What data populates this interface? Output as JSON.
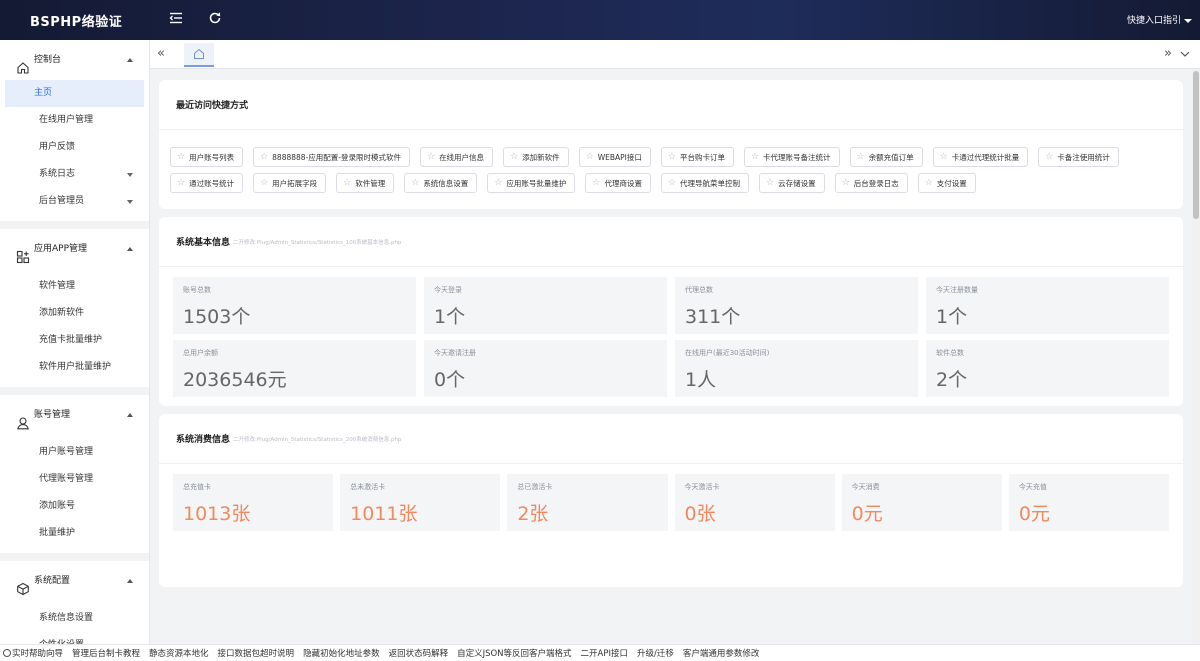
{
  "app": {
    "title": "BSPHP络验证",
    "quick_menu": "快捷入口指引"
  },
  "sidebar": {
    "groups": [
      {
        "label": "控制台",
        "icon": "home-icon",
        "items": [
          {
            "label": "主页",
            "active": true
          },
          {
            "label": "在线用户管理"
          },
          {
            "label": "用户反馈"
          },
          {
            "label": "系统日志",
            "has_submenu": true
          },
          {
            "label": "后台管理员",
            "has_submenu": true
          }
        ]
      },
      {
        "label": "应用APP管理",
        "icon": "apps-icon",
        "items": [
          {
            "label": "软件管理"
          },
          {
            "label": "添加新软件"
          },
          {
            "label": "充值卡批量维护"
          },
          {
            "label": "软件用户批量维护"
          }
        ]
      },
      {
        "label": "账号管理",
        "icon": "user-icon",
        "items": [
          {
            "label": "用户账号管理"
          },
          {
            "label": "代理账号管理"
          },
          {
            "label": "添加账号"
          },
          {
            "label": "批量维护"
          }
        ]
      },
      {
        "label": "系统配置",
        "icon": "cube-icon",
        "items": [
          {
            "label": "系统信息设置"
          },
          {
            "label": "个性化设置"
          }
        ]
      }
    ]
  },
  "shortcuts": {
    "title": "最近访问快捷方式",
    "items": [
      "用户账号列表",
      "8888888-应用配置-登录限时模式软件",
      "在线用户信息",
      "添加新软件",
      "WEBAPI接口",
      "平台购卡订单",
      "卡代理账号备注统计",
      "余额充值订单",
      "卡通过代理统计批量",
      "卡备注使用统计",
      "通过账号统计",
      "用户拓展字段",
      "软件管理",
      "系统信息设置",
      "应用账号批量维护",
      "代理商设置",
      "代理导航菜单控制",
      "云存储设置",
      "后台登录日志",
      "支付设置"
    ]
  },
  "basic_info": {
    "title": "系统基本信息",
    "note": "二开修改:Plug/Admin_Statistics/Statistics_100系统基本信息.php",
    "stats": [
      {
        "label": "账号总数",
        "value": "1503个"
      },
      {
        "label": "今天登录",
        "value": "1个"
      },
      {
        "label": "代理总数",
        "value": "311个"
      },
      {
        "label": "今天注册数量",
        "value": "1个"
      },
      {
        "label": "总用户余额",
        "value": "2036546元"
      },
      {
        "label": "今天邀请注册",
        "value": "0个"
      },
      {
        "label": "在线用户(最近30活动时间)",
        "value": "1人"
      },
      {
        "label": "软件总数",
        "value": "2个"
      }
    ]
  },
  "consume_info": {
    "title": "系统消费信息",
    "note": "二开修改:Plug/Admin_Statistics/Statistics_200系统消费信息.php",
    "stats": [
      {
        "label": "总充值卡",
        "value": "1013张"
      },
      {
        "label": "总未激活卡",
        "value": "1011张"
      },
      {
        "label": "总已激活卡",
        "value": "2张"
      },
      {
        "label": "今天激活卡",
        "value": "0张"
      },
      {
        "label": "今天消费",
        "value": "0元"
      },
      {
        "label": "今天充值",
        "value": "0元"
      }
    ],
    "accent": "#f08a5d"
  },
  "footer": {
    "items": [
      "实时帮助向导",
      "管理后台制卡教程",
      "静态资源本地化",
      "接口数据包超时说明",
      "隐藏初始化地址参数",
      "返回状态码解释",
      "自定义JSON等反回客户端格式",
      "二开API接口",
      "升级/迁移",
      "客户端通用参数修改"
    ]
  },
  "colors": {
    "topbar": "#1d2650",
    "active_menu_bg": "#e6eefc",
    "active_menu_text": "#2b6fe0"
  }
}
